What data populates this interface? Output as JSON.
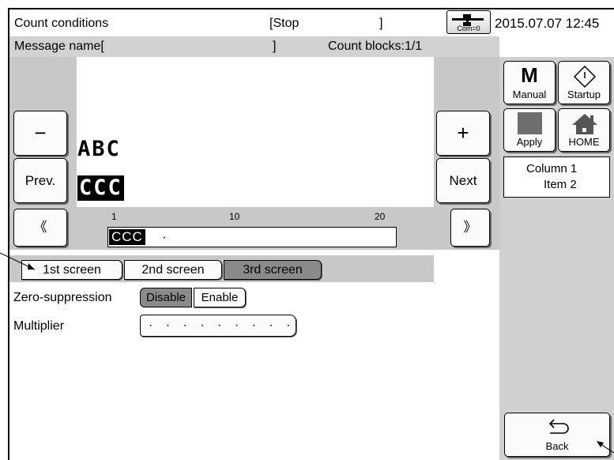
{
  "header": {
    "title": "Count conditions",
    "status": "[Stop",
    "status_close": "]",
    "com_label": "Com=0",
    "datetime": "2015.07.07 12:45",
    "message_name": "Message name[",
    "message_name_close": "]",
    "count_blocks": "Count blocks:1/1"
  },
  "preview": {
    "minus_label": "−",
    "plus_label": "+",
    "prev_label": "Prev.",
    "next_label": "Next",
    "line1_text": "ABC",
    "line2_text": "CCC",
    "scroll_left_label": "《",
    "scroll_right_label": "》",
    "ruler_numbers": [
      "1",
      "10",
      "20"
    ],
    "ruler_field_text": "CCC",
    "ruler_cursor": "·"
  },
  "tabs": [
    {
      "label": "1st screen",
      "active": false
    },
    {
      "label": "2nd screen",
      "active": false
    },
    {
      "label": "3rd screen",
      "active": true
    }
  ],
  "settings": {
    "zero_suppression_label": "Zero-suppression",
    "disable_label": "Disable",
    "enable_label": "Enable",
    "zero_suppression_selected": "Disable",
    "multiplier_label": "Multiplier",
    "multiplier_value": "· · · · · · · · · · ·"
  },
  "side": {
    "manual_letter": "M",
    "manual_label": "Manual",
    "startup_label": "Startup",
    "apply_label": "Apply",
    "home_label": "HOME",
    "column_label": "Column 1",
    "item_label": "Item 2",
    "back_label": "Back"
  },
  "colors": {
    "panel_gray": "#d0d0d0",
    "selected_gray": "#8a8a8a",
    "button_face": "#fbfbfb"
  }
}
